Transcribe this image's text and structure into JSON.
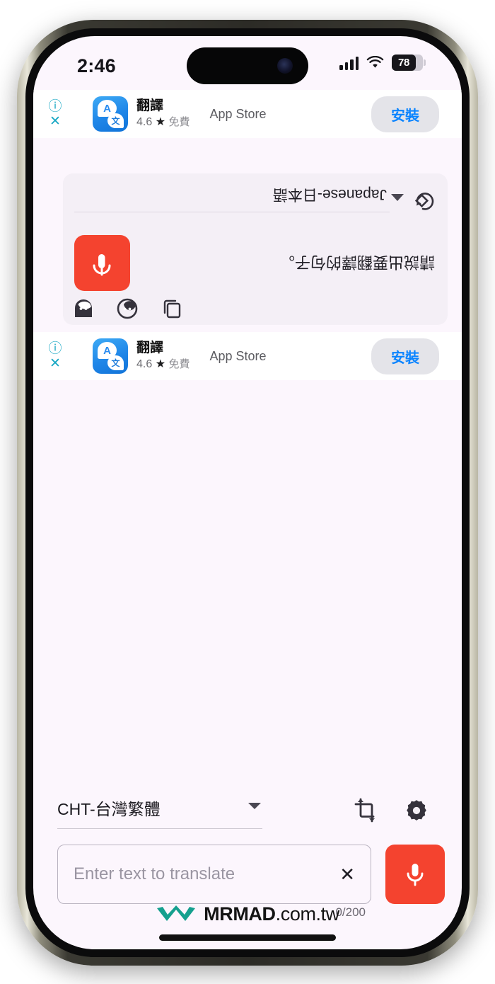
{
  "status_bar": {
    "time": "2:46",
    "signal_icon": "cellular-bars-icon",
    "wifi_icon": "wifi-icon",
    "battery_percent": "78",
    "battery_icon": "battery-icon"
  },
  "ad_banner": {
    "info_icon": "info-icon",
    "close_icon": "close-icon",
    "app_icon": "translate-app-icon",
    "app_icon_letter_primary": "A",
    "app_icon_letter_secondary": "文",
    "app_name": "翻譯",
    "rating": "4.6",
    "star": "★",
    "price": "免費",
    "store": "App Store",
    "install_label": "安裝"
  },
  "translation_card": {
    "copy_icon": "copy-icon",
    "face_outline_icon": "speech-face-outline-icon",
    "face_filled_icon": "speech-face-filled-icon",
    "mic_icon": "microphone-icon",
    "prompt_text": "請說出要翻譯的句子。",
    "language": "Japanese-日本語",
    "caret_icon": "chevron-up-icon",
    "rotate_icon": "rotate-diamond-icon"
  },
  "bottom_bar": {
    "language": "CHT-台灣繁體",
    "caret_icon": "chevron-down-icon",
    "crop_icon": "crop-rotate-icon",
    "settings_icon": "gear-icon",
    "input_placeholder": "Enter text to translate",
    "input_value": "",
    "clear_icon": "close-icon",
    "mic_icon": "microphone-icon",
    "char_counter": "0/200"
  },
  "watermark": {
    "logo_icon": "mrmad-logo-icon",
    "brand": "MRMAD",
    "domain": ".com.tw"
  },
  "colors": {
    "accent_red": "#F4432F",
    "link_blue": "#0A84FF",
    "screen_bg": "#FCF6FD",
    "card_bg": "#F4EFF6",
    "teal": "#15A08E"
  }
}
